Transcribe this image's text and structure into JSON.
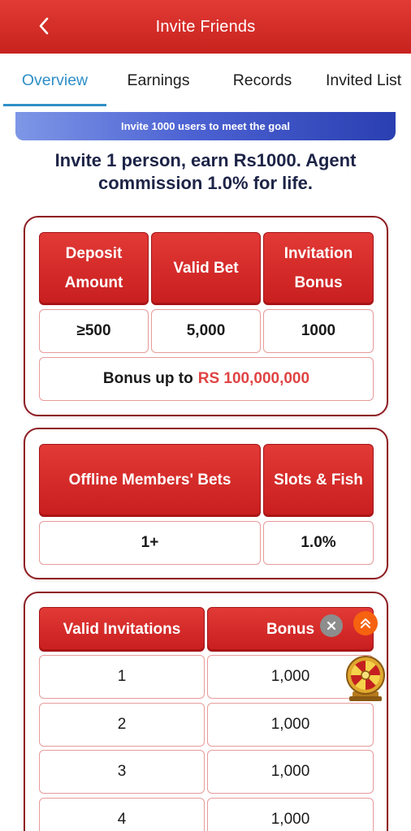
{
  "header": {
    "title": "Invite Friends"
  },
  "tabs": [
    {
      "label": "Overview"
    },
    {
      "label": "Earnings"
    },
    {
      "label": "Records"
    },
    {
      "label": "Invited List"
    }
  ],
  "goal_banner": "Invite 1000 users to meet the goal",
  "headline": "Invite 1 person, earn Rs1000. Agent commission 1.0% for life.",
  "card1": {
    "headers": [
      "Deposit Amount",
      "Valid Bet",
      "Invitation Bonus"
    ],
    "values": [
      "≥500",
      "5,000",
      "1000"
    ],
    "bonus_prefix": "Bonus up to",
    "bonus_amount": "RS 100,000,000"
  },
  "card2": {
    "headers": [
      "Offline Members' Bets",
      "Slots & Fish"
    ],
    "values": [
      "1+",
      "1.0%"
    ]
  },
  "card3": {
    "headers": [
      "Valid Invitations",
      "Bonus"
    ],
    "rows": [
      {
        "invitations": "1",
        "bonus": "1,000"
      },
      {
        "invitations": "2",
        "bonus": "1,000"
      },
      {
        "invitations": "3",
        "bonus": "1,000"
      },
      {
        "invitations": "4",
        "bonus": "1,000"
      }
    ]
  },
  "colors": {
    "header_red": "#d42b27",
    "tab_active": "#2e8fc7",
    "card_border": "#8e1c22",
    "bonus_text": "#e04343",
    "headline_navy": "#1d2447"
  },
  "icons": {
    "back": "chevron-left-icon",
    "close": "close-icon",
    "scroll_top": "double-chevron-up-icon",
    "lucky_wheel": "lucky-wheel-icon"
  }
}
